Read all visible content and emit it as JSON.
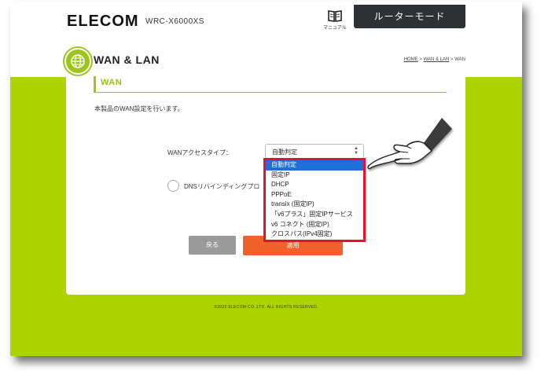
{
  "header": {
    "brand": "ELECOM",
    "model": "WRC-X6000XS",
    "manual_label": "マニュアル",
    "mode_button": "ルーターモード"
  },
  "section": {
    "title": "WAN & LAN",
    "breadcrumb": [
      "HOME",
      "WAN & LAN",
      "WAN"
    ],
    "breadcrumb_sep": ">"
  },
  "panel": {
    "heading": "WAN",
    "description": "本製品のWAN設定を行います。",
    "access_type_label": "WANアクセスタイプ：",
    "access_type_value": "自動判定",
    "dns_label": "DNSリバインディングプロ",
    "back_button": "戻る",
    "apply_button": "適用"
  },
  "dropdown": {
    "selected_index": 0,
    "options": [
      "自動判定",
      "固定IP",
      "DHCP",
      "PPPoE",
      "transix (固定IP)",
      "「v6プラス」固定IPサービス",
      "v6 コネクト (固定IP)",
      "クロスパス(IPv4固定)"
    ]
  },
  "footer": {
    "copyright": "©2022 ELECOM CO.,LTD. ALL RIGHTS RESERVED."
  },
  "colors": {
    "green": "#aed400",
    "accent": "#9bc51a",
    "apply": "#f0612b",
    "highlight": "#e8112c",
    "selected": "#1e6fd8"
  }
}
